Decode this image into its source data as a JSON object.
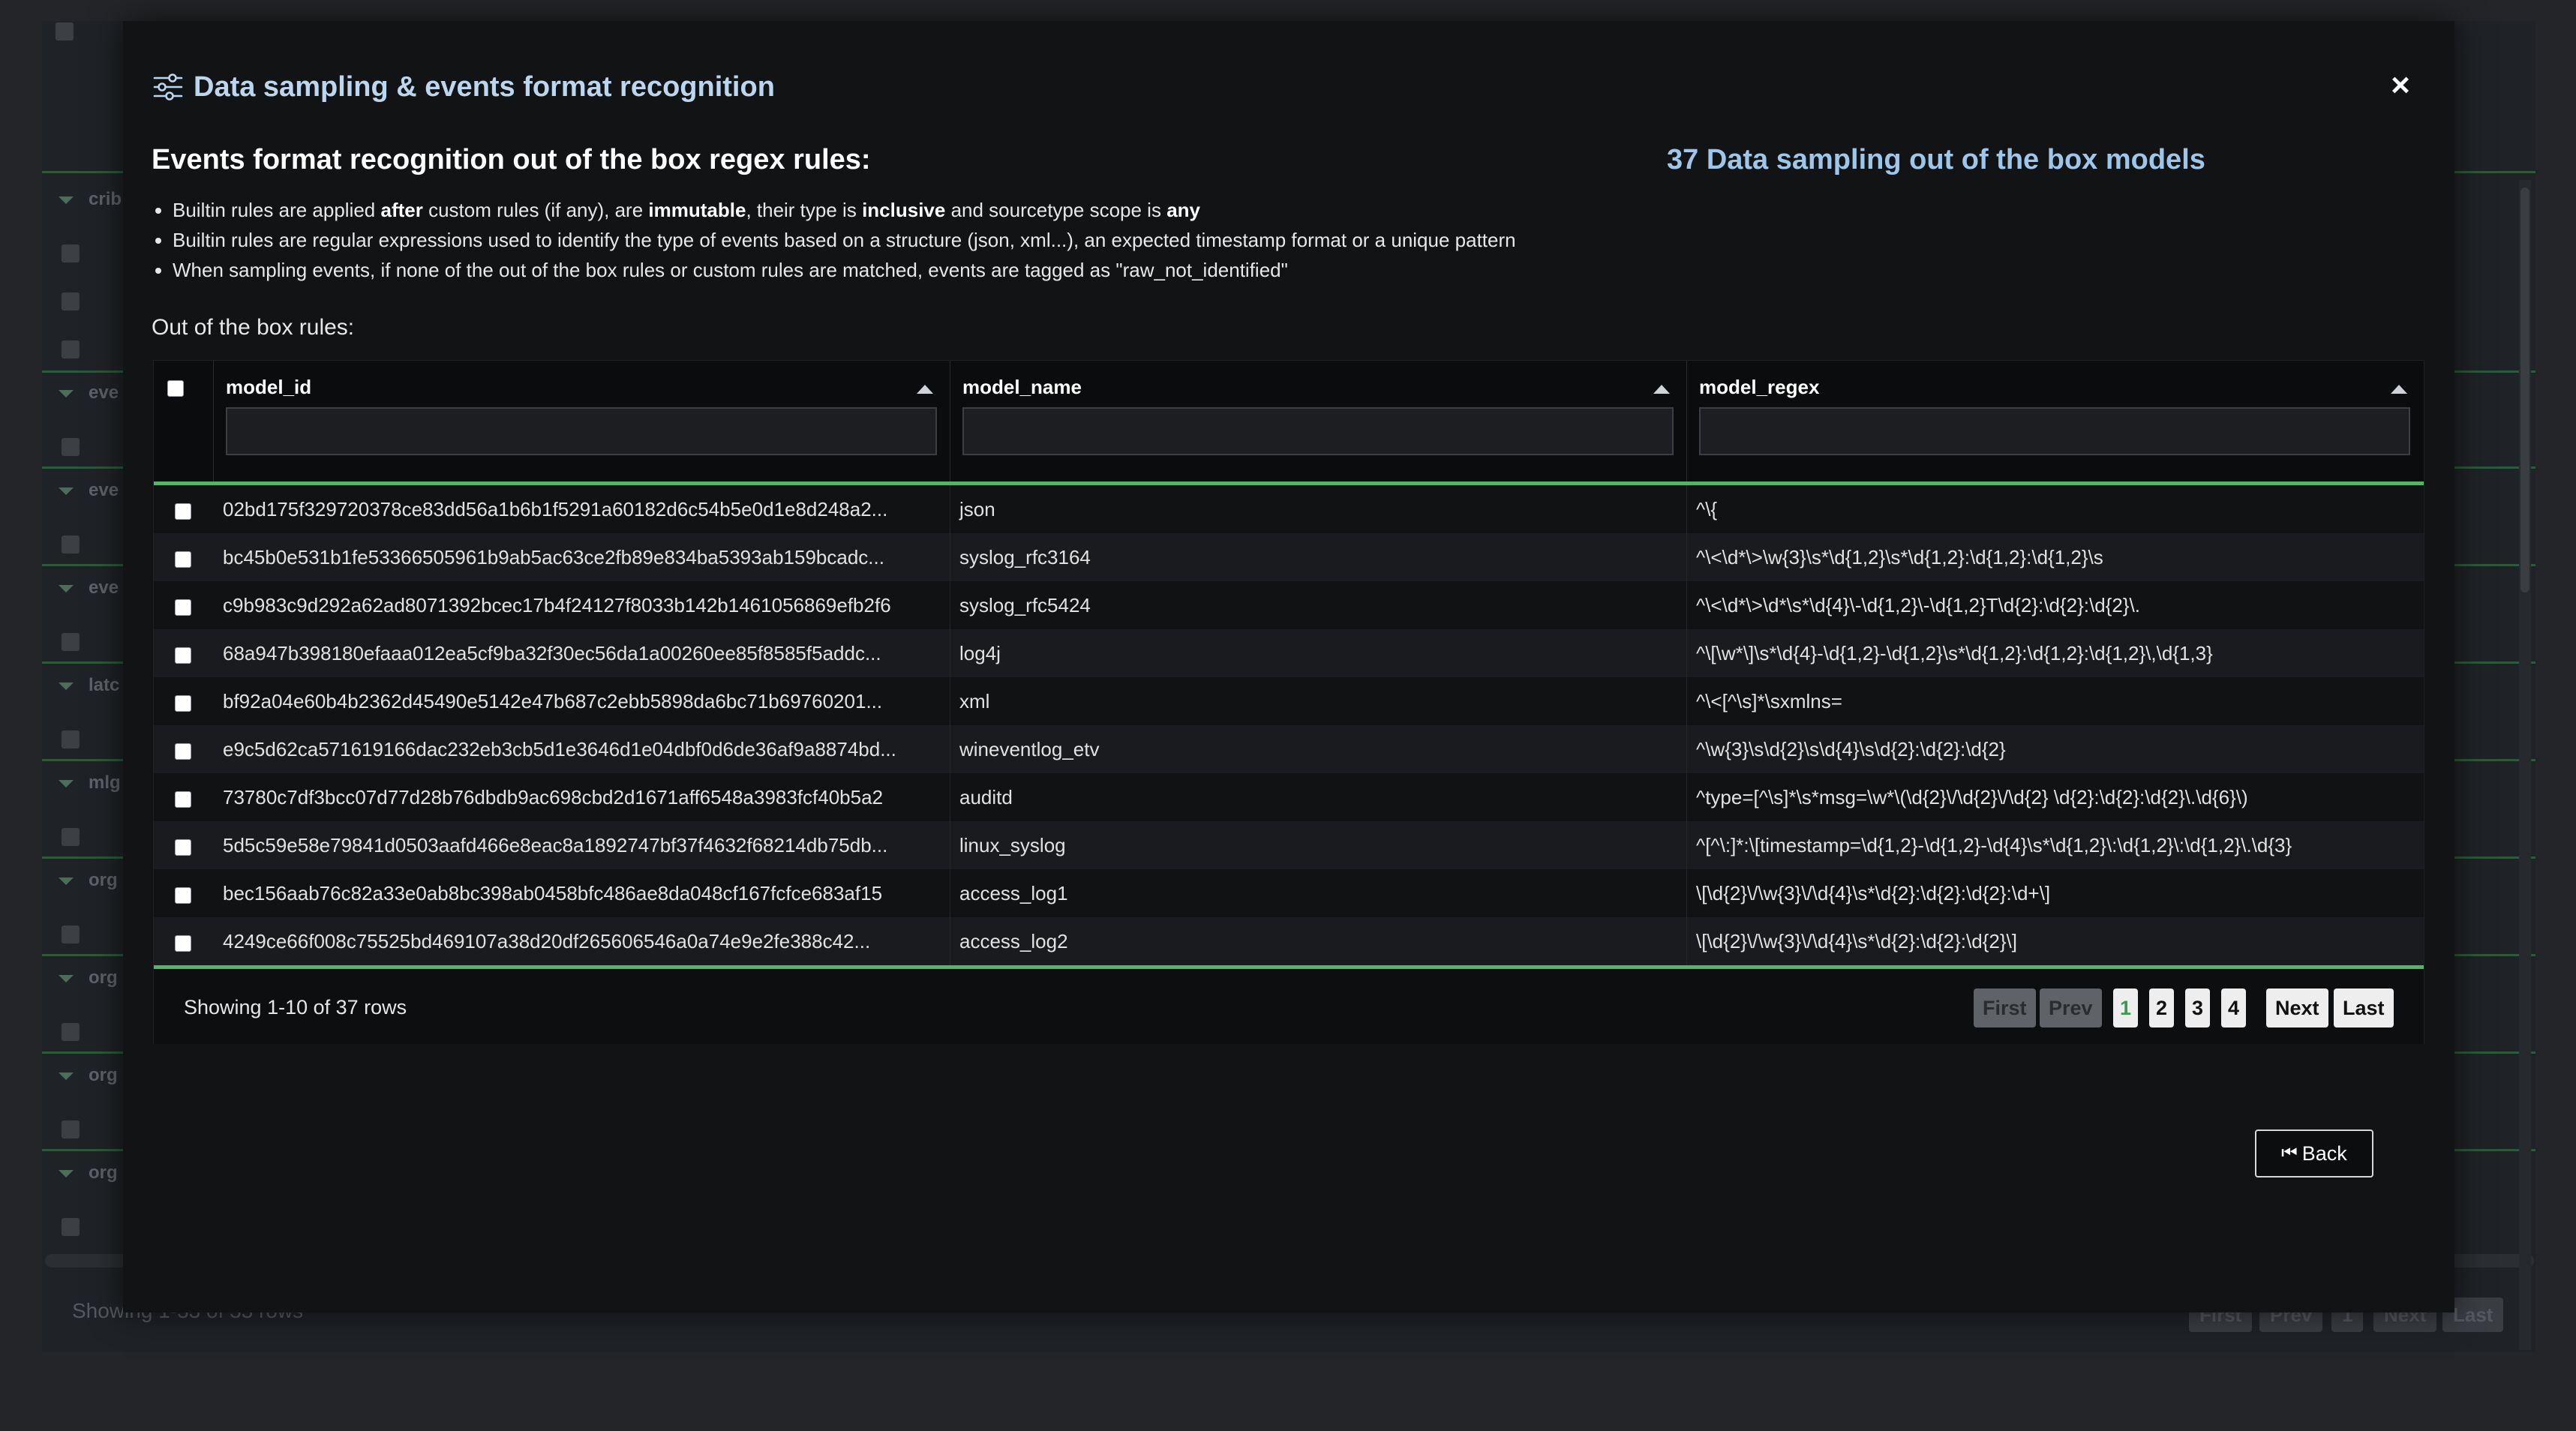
{
  "modal": {
    "title": "Data sampling & events format recognition",
    "close_symbol": "×",
    "section_title": "Events format recognition out of the box regex rules:",
    "models_link": "37 Data sampling out of the box models",
    "bullets": [
      {
        "t1": "Builtin rules are applied ",
        "b1": "after",
        "t2": " custom rules (if any), are ",
        "b2": "immutable",
        "t3": ", their type is ",
        "b3": "inclusive",
        "t4": " and sourcetype scope is ",
        "b4": "any"
      },
      {
        "text": "Builtin rules are regular expressions used to identify the type of events based on a structure (json, xml...), an expected timestamp format or a unique pattern"
      },
      {
        "text": "When sampling events, if none of the out of the box rules or custom rules are matched, events are tagged as \"raw_not_identified\""
      }
    ],
    "ootb_label": "Out of the box rules:",
    "back_label": "Back",
    "back_icon": "⏮"
  },
  "table": {
    "columns": [
      {
        "label": "model_id",
        "filter_placeholder": ""
      },
      {
        "label": "model_name",
        "filter_placeholder": ""
      },
      {
        "label": "model_regex",
        "filter_placeholder": ""
      }
    ],
    "rows": [
      {
        "model_id": "02bd175f329720378ce83dd56a1b6b1f5291a60182d6c54b5e0d1e8d248a2...",
        "model_name": "json",
        "model_regex": "^\\{"
      },
      {
        "model_id": "bc45b0e531b1fe53366505961b9ab5ac63ce2fb89e834ba5393ab159bcadc...",
        "model_name": "syslog_rfc3164",
        "model_regex": "^\\<\\d*\\>\\w{3}\\s*\\d{1,2}\\s*\\d{1,2}:\\d{1,2}:\\d{1,2}\\s"
      },
      {
        "model_id": "c9b983c9d292a62ad8071392bcec17b4f24127f8033b142b1461056869efb2f6",
        "model_name": "syslog_rfc5424",
        "model_regex": "^\\<\\d*\\>\\d*\\s*\\d{4}\\-\\d{1,2}\\-\\d{1,2}T\\d{2}:\\d{2}:\\d{2}\\."
      },
      {
        "model_id": "68a947b398180efaaa012ea5cf9ba32f30ec56da1a00260ee85f8585f5addc...",
        "model_name": "log4j",
        "model_regex": "^\\[\\w*\\]\\s*\\d{4}-\\d{1,2}-\\d{1,2}\\s*\\d{1,2}:\\d{1,2}:\\d{1,2}\\,\\d{1,3}"
      },
      {
        "model_id": "bf92a04e60b4b2362d45490e5142e47b687c2ebb5898da6bc71b69760201...",
        "model_name": "xml",
        "model_regex": "^\\<[^\\s]*\\sxmlns="
      },
      {
        "model_id": "e9c5d62ca571619166dac232eb3cb5d1e3646d1e04dbf0d6de36af9a8874bd...",
        "model_name": "wineventlog_etv",
        "model_regex": "^\\w{3}\\s\\d{2}\\s\\d{4}\\s\\d{2}:\\d{2}:\\d{2}"
      },
      {
        "model_id": "73780c7df3bcc07d77d28b76dbdb9ac698cbd2d1671aff6548a3983fcf40b5a2",
        "model_name": "auditd",
        "model_regex": "^type=[^\\s]*\\s*msg=\\w*\\(\\d{2}\\/\\d{2}\\/\\d{2} \\d{2}:\\d{2}:\\d{2}\\.\\d{6}\\)"
      },
      {
        "model_id": "5d5c59e58e79841d0503aafd466e8eac8a1892747bf37f4632f68214db75db...",
        "model_name": "linux_syslog",
        "model_regex": "^[^\\:]*:\\[timestamp=\\d{1,2}-\\d{1,2}-\\d{4}\\s*\\d{1,2}\\:\\d{1,2}\\:\\d{1,2}\\.\\d{3}"
      },
      {
        "model_id": "bec156aab76c82a33e0ab8bc398ab0458bfc486ae8da048cf167fcfce683af15",
        "model_name": "access_log1",
        "model_regex": "\\[\\d{2}\\/\\w{3}\\/\\d{4}\\s*\\d{2}:\\d{2}:\\d{2}:\\d+\\]"
      },
      {
        "model_id": "4249ce66f008c75525bd469107a38d20df265606546a0a74e9e2fe388c42...",
        "model_name": "access_log2",
        "model_regex": "\\[\\d{2}\\/\\w{3}\\/\\d{4}\\s*\\d{2}:\\d{2}:\\d{2}\\]"
      }
    ],
    "footer": {
      "rows_info": "Showing 1-10 of 37 rows",
      "first": "First",
      "prev": "Prev",
      "pages": [
        "1",
        "2",
        "3",
        "4"
      ],
      "active_page": "1",
      "next": "Next",
      "last": "Last"
    }
  },
  "background": {
    "group_labels": [
      "crib",
      "eve",
      "eve",
      "eve",
      "latc",
      "mlg",
      "org",
      "org",
      "org",
      "org"
    ],
    "footer_text": "Showing 1-33 of 33 rows",
    "footer_buttons": [
      "First",
      "Prev",
      "1",
      "Next",
      "Last"
    ]
  },
  "colors": {
    "accent_green": "#56b46a",
    "title_blue": "#bcd6ef",
    "link_blue": "#9ec5ea"
  }
}
